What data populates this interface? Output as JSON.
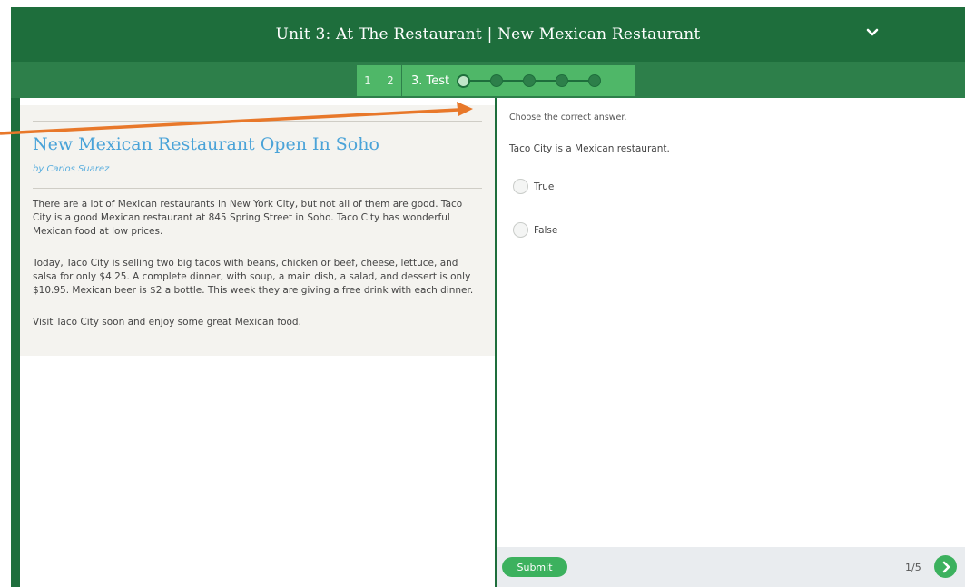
{
  "header": {
    "title": "Unit 3: At The Restaurant | New Mexican Restaurant",
    "dropdown_icon": "chevron-down-icon"
  },
  "steps": {
    "items": [
      "1",
      "2"
    ],
    "current_label": "3. Test",
    "progress_dots_total": 5,
    "progress_current_index": 1
  },
  "article": {
    "title": "New Mexican Restaurant Open In Soho",
    "byline": "by Carlos Suarez",
    "paragraphs": [
      "There are a lot of Mexican restaurants in New York City, but not all of them are good. Taco City is a good Mexican restaurant at 845 Spring Street in Soho. Taco City has wonderful Mexican food at low prices.",
      "Today, Taco City is selling two big tacos with beans, chicken or beef, cheese, lettuce, and salsa for only $4.25. A complete dinner, with soup, a main dish, a salad, and dessert is only $10.95. Mexican beer is $2 a bottle. This week they are giving a free drink with each dinner.",
      "Visit Taco City soon and enjoy some great Mexican food."
    ]
  },
  "question": {
    "instruction": "Choose the correct answer.",
    "text": "Taco City is a Mexican restaurant.",
    "options": [
      "True",
      "False"
    ]
  },
  "footer": {
    "submit_label": "Submit",
    "pager": "1/5"
  },
  "colors": {
    "header": "#1e6e3c",
    "subbar": "#2d7f4a",
    "step_active": "#4fb768",
    "accent": "#3cb15e",
    "article_title": "#4aa3d8",
    "annotation_arrow": "#e8782a"
  }
}
